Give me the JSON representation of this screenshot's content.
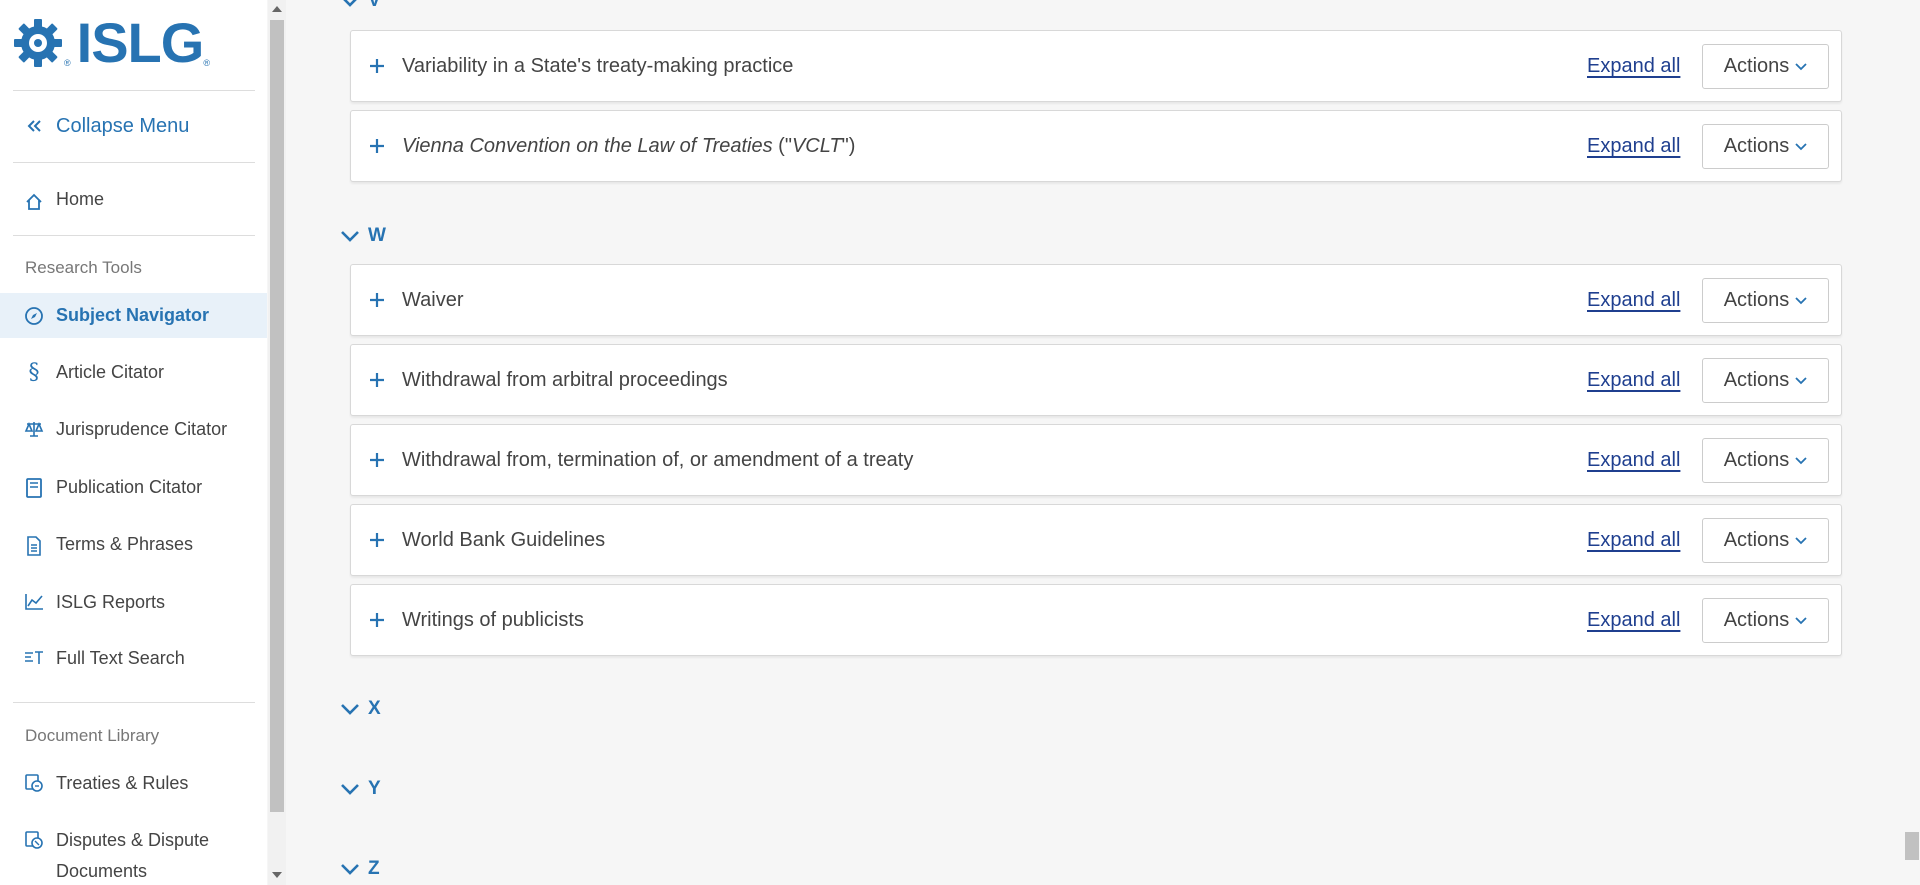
{
  "logo": {
    "text": "ISLG",
    "reg": "®"
  },
  "sidebar": {
    "collapse_label": "Collapse Menu",
    "home_label": "Home",
    "research_title": "Research Tools",
    "research_items": [
      {
        "label": "Subject Navigator",
        "icon": "compass-icon",
        "active": true
      },
      {
        "label": "Article Citator",
        "icon": "section-icon"
      },
      {
        "label": "Jurisprudence Citator",
        "icon": "scales-icon"
      },
      {
        "label": "Publication Citator",
        "icon": "book-icon"
      },
      {
        "label": "Terms & Phrases",
        "icon": "document-icon"
      },
      {
        "label": "ISLG Reports",
        "icon": "chart-line-icon"
      },
      {
        "label": "Full Text Search",
        "icon": "text-search-icon"
      }
    ],
    "library_title": "Document Library",
    "library_items": [
      {
        "label": "Treaties & Rules",
        "icon": "treaty-icon"
      },
      {
        "label": "Disputes & Dispute",
        "label2": "Documents",
        "icon": "disputes-icon"
      }
    ]
  },
  "main": {
    "letter_v": "V",
    "v_cards": [
      {
        "title": "Variability in a State's treaty-making practice"
      },
      {
        "title_italic": "Vienna Convention on the Law of Treaties",
        "title_a": " (\"",
        "title_b_italic": "VCLT",
        "title_c": "\")"
      }
    ],
    "letter_w": "W",
    "w_cards": [
      {
        "title": "Waiver"
      },
      {
        "title": "Withdrawal from arbitral proceedings"
      },
      {
        "title": "Withdrawal from, termination of, or amendment of a treaty"
      },
      {
        "title": "World Bank Guidelines"
      },
      {
        "title": "Writings of publicists"
      }
    ],
    "letter_x": "X",
    "letter_y": "Y",
    "letter_z": "Z",
    "expand_all_label": "Expand all",
    "actions_label": "Actions"
  },
  "colors": {
    "accent": "#2773b2",
    "link": "#1f3f8f",
    "active_bg": "#e8f1f9"
  }
}
